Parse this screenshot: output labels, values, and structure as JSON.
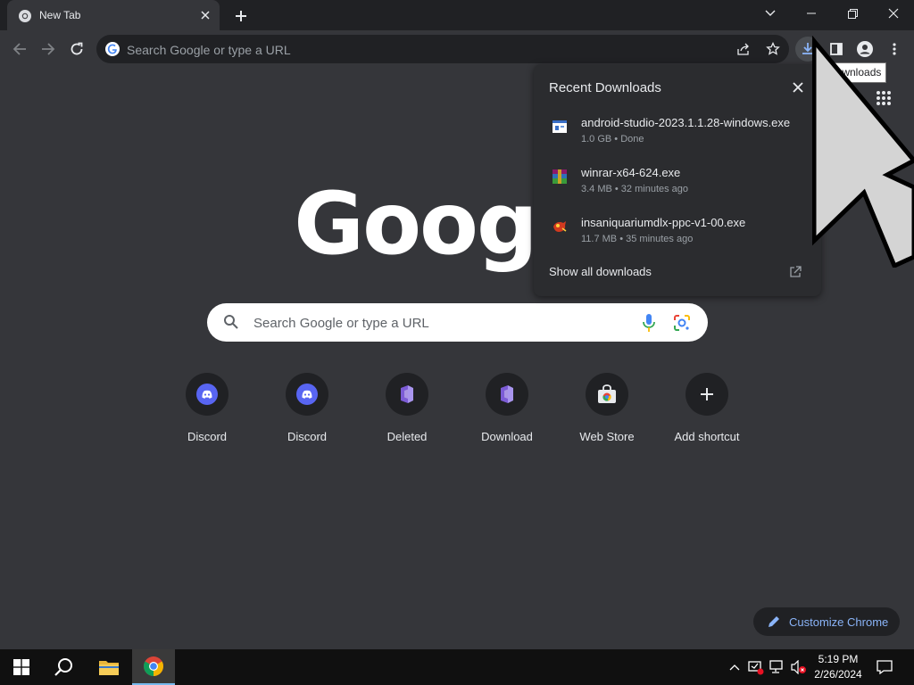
{
  "tab": {
    "title": "New Tab"
  },
  "toolbar": {
    "omnibox_placeholder": "Search Google or type a URL",
    "downloads_tooltip": "Downloads"
  },
  "ntp": {
    "logo_text": "Google",
    "search_placeholder": "Search Google or type a URL",
    "shortcuts": [
      {
        "label": "Discord",
        "icon": "discord-icon"
      },
      {
        "label": "Discord",
        "icon": "discord-icon"
      },
      {
        "label": "Deleted",
        "icon": "purple-box-icon"
      },
      {
        "label": "Download",
        "icon": "purple-box-icon"
      },
      {
        "label": "Web Store",
        "icon": "web-store-icon"
      },
      {
        "label": "Add shortcut",
        "icon": "plus-icon"
      }
    ],
    "customize_label": "Customize Chrome"
  },
  "downloads": {
    "title": "Recent Downloads",
    "items": [
      {
        "name": "android-studio-2023.1.1.28-windows.exe",
        "meta": "1.0 GB • Done",
        "icon": "installer-icon"
      },
      {
        "name": "winrar-x64-624.exe",
        "meta": "3.4 MB • 32 minutes ago",
        "icon": "winrar-icon"
      },
      {
        "name": "insaniquariumdlx-ppc-v1-00.exe",
        "meta": "11.7 MB • 35 minutes ago",
        "icon": "game-icon"
      }
    ],
    "show_all": "Show all downloads"
  },
  "taskbar": {
    "time": "5:19 PM",
    "date": "2/26/2024"
  },
  "colors": {
    "background": "#35363a",
    "frame": "#202124",
    "accent": "#8ab4f8",
    "discord": "#5865f2"
  }
}
